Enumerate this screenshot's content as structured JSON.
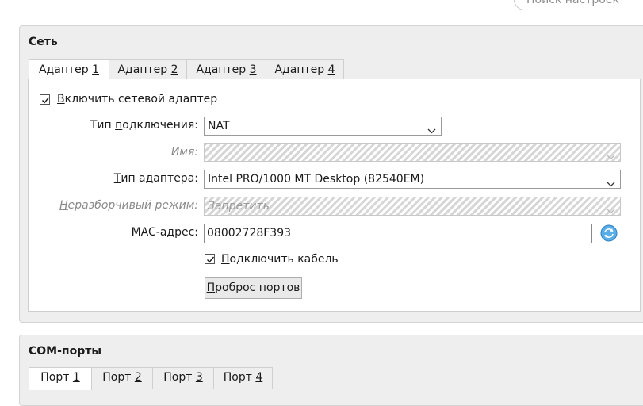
{
  "search": {
    "placeholder": "Поиск настроек"
  },
  "network": {
    "title": "Сеть",
    "tabs": [
      {
        "label": "Адаптер ",
        "key": "1"
      },
      {
        "label": "Адаптер ",
        "key": "2"
      },
      {
        "label": "Адаптер ",
        "key": "3"
      },
      {
        "label": "Адаптер ",
        "key": "4"
      }
    ],
    "enable_adapter": {
      "pre": "",
      "key": "В",
      "post": "ключить сетевой адаптер",
      "checked": true
    },
    "attachment": {
      "label_pre": "Тип ",
      "label_key": "п",
      "label_post": "одключения:",
      "value": "NAT"
    },
    "name": {
      "label": "Имя:",
      "value": ""
    },
    "adapter_type": {
      "label_pre": "",
      "label_key": "Т",
      "label_post": "ип адаптера:",
      "value": "Intel PRO/1000 MT Desktop (82540EM)"
    },
    "promiscuous": {
      "label_pre": "",
      "label_key": "Н",
      "label_post": "еразборчивый режим:",
      "value": "Запретить"
    },
    "mac": {
      "label": "MAC-адрес:",
      "value": "08002728F393"
    },
    "cable": {
      "pre": "",
      "key": "П",
      "post": "одключить кабель",
      "checked": true
    },
    "port_forwarding": {
      "pre": "",
      "key": "П",
      "post": "роброс портов"
    }
  },
  "com": {
    "title": "COM-порты",
    "tabs": [
      {
        "label": "Порт ",
        "key": "1"
      },
      {
        "label": "Порт ",
        "key": "2"
      },
      {
        "label": "Порт ",
        "key": "3"
      },
      {
        "label": "Порт ",
        "key": "4"
      }
    ]
  },
  "colors": {
    "accent": "#3a8fd9",
    "panel_bg": "#eeeeee"
  }
}
